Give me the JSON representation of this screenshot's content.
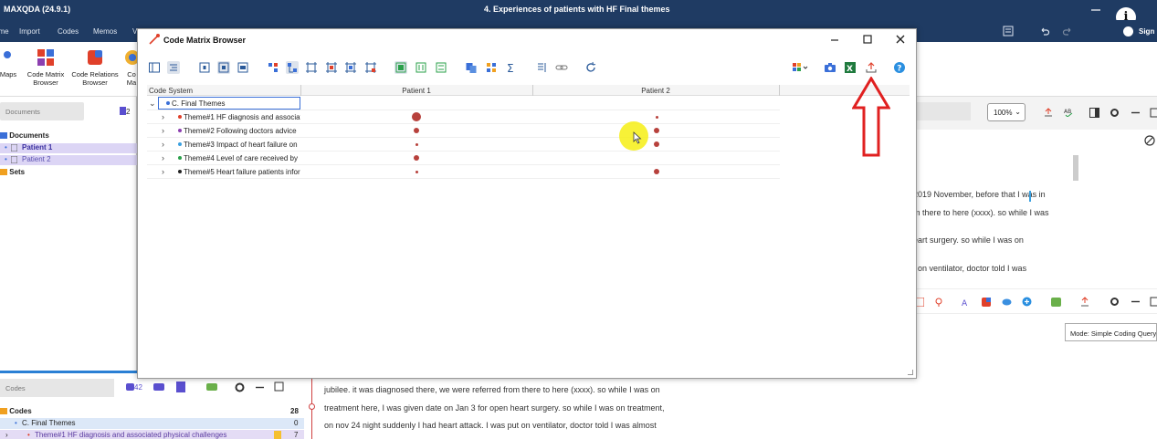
{
  "app": {
    "name": "MAXQDA (24.9.1)",
    "document_title": "4. Experiences of patients with HF Final themes",
    "info_glyph": "i",
    "sign_in_label": "Sign"
  },
  "menu": [
    "ome",
    "Import",
    "Codes",
    "Memos",
    "V"
  ],
  "ribbon": {
    "maps_label": "Maps",
    "code_matrix_label_1": "Code Matrix",
    "code_matrix_label_2": "Browser",
    "code_relations_label_1": "Code Relations",
    "code_relations_label_2": "Browser",
    "cut_label_1": "Co",
    "cut_label_2": "Ma"
  },
  "left_panel": {
    "search_placeholder": "Documents",
    "count_badge": "2",
    "documents_label": "Documents",
    "patient1": "Patient 1",
    "patient2": "Patient 2",
    "sets_label": "Sets"
  },
  "codes_panel": {
    "search_placeholder": "Codes",
    "count_badge": "42",
    "codes_label": "Codes",
    "codes_count": "28",
    "final_themes": "C. Final Themes",
    "final_themes_count": "0",
    "theme1_full": "Theme#1 HF diagnosis and associated physical challenges",
    "theme1_count": "7"
  },
  "dialog": {
    "title": "Code Matrix Browser",
    "column_header": "Code System",
    "patient_columns": [
      "Patient 1",
      "Patient 2"
    ],
    "root_code": "C. Final Themes",
    "themes": [
      {
        "label": "Theme#1 HF diagnosis and associat",
        "color": "#e0402a",
        "p1": 3,
        "p2": 1
      },
      {
        "label": "Theme#2 Following doctors advice",
        "color": "#8c3fb0",
        "p1": 2,
        "p2": 2
      },
      {
        "label": "Theme#3 Impact of heart failure on",
        "color": "#3aa0e0",
        "p1": 1,
        "p2": 2
      },
      {
        "label": "Theme#4 Level of care received  by",
        "color": "#2aa04a",
        "p1": 2,
        "p2": 0
      },
      {
        "label": "Theme#5 Heart failure patients infor",
        "color": "#222222",
        "p1": 1,
        "p2": 2
      }
    ]
  },
  "right_panel": {
    "zoom": "100%",
    "lines": [
      "2019 November, before that I was in",
      "m there to here (xxxx). so while I was",
      "eart surgery. so while I was on",
      "t on ventilator, doctor told I was"
    ],
    "mode": "Mode: Simple Coding Query"
  },
  "document_text": [
    "jubilee. it was diagnosed there, we were referred from there to here (xxxx). so while I was on",
    "treatment here, I was given date on Jan 3 for open heart surgery. so while I was on treatment,",
    "on nov 24 night suddenly I had heart attack. I was put on ventilator, doctor told I was almost"
  ],
  "colors": {
    "titlebar": "#1f3b63",
    "node": "#b7413c",
    "annotation_arrow": "#e02020",
    "cursor_highlight": "#f6ee14"
  }
}
